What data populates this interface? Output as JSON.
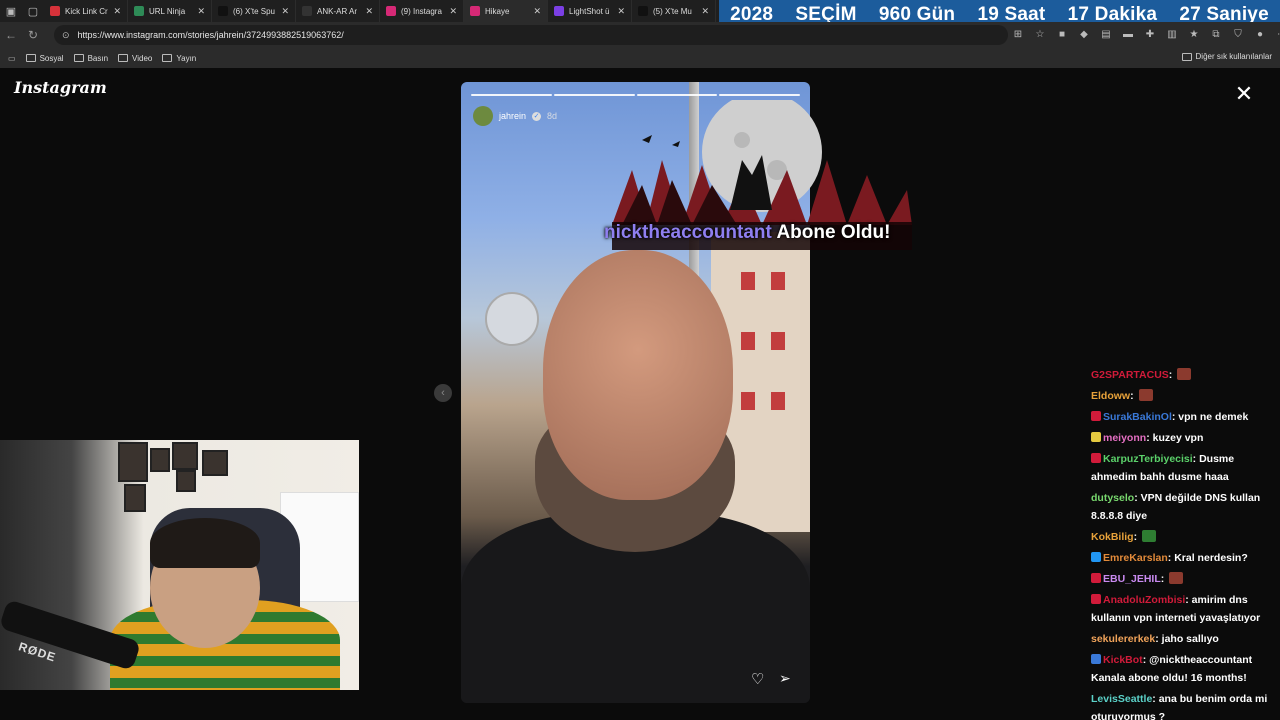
{
  "browser": {
    "tabs": [
      {
        "title": "Kick Link Cr",
        "color": "#d6323a",
        "active": false
      },
      {
        "title": "URL Ninja",
        "color": "#2e8b57",
        "active": false
      },
      {
        "title": "(6) X'te Spu",
        "color": "#111111",
        "active": false
      },
      {
        "title": "ANK-AR Ar",
        "color": "#333333",
        "active": false
      },
      {
        "title": "(9) Instagra",
        "color": "#d62976",
        "active": false
      },
      {
        "title": "Hikaye",
        "color": "#d62976",
        "active": true
      },
      {
        "title": "LightShot ü",
        "color": "#7b3fe4",
        "active": false
      },
      {
        "title": "(5) X'te Mu",
        "color": "#111111",
        "active": false
      }
    ],
    "url": "https://www.instagram.com/stories/jahrein/3724993882519063762/",
    "bookmarks": [
      "Sosyal",
      "Basın",
      "Video",
      "Yayın"
    ],
    "other_bookmarks": "Diğer sık kullanılanlar"
  },
  "countdown": {
    "year": "2028",
    "label": "SEÇİM",
    "days": "960 Gün",
    "hours": "19 Saat",
    "minutes": "17 Dakika",
    "seconds": "27 Saniye"
  },
  "instagram": {
    "logo": "Instagram",
    "story": {
      "username": "jahrein",
      "age": "8d",
      "progress_segments": 4
    }
  },
  "alert": {
    "name": "nicktheaccountant",
    "message": "Abone Oldu!"
  },
  "webcam": {
    "mic_brand": "RØDE"
  },
  "chat": [
    {
      "user": "G2SPARTACUS",
      "color": "#d11b3a",
      "text": "",
      "badge": "",
      "emote": "#8b3a2e"
    },
    {
      "user": "Eldoww",
      "color": "#e8a23a",
      "text": "",
      "badge": "",
      "emote": "#8b3a2e"
    },
    {
      "user": "SurakBakinOl",
      "color": "#3a79d8",
      "text": "vpn ne demek",
      "badge": "#d11b3a",
      "emote": ""
    },
    {
      "user": "meiyonn",
      "color": "#e56fc3",
      "text": "kuzey vpn",
      "badge": "#e4c940",
      "emote": ""
    },
    {
      "user": "KarpuzTerbiyecisi",
      "color": "#5bd16a",
      "text": "Dusme ahmedim bahh dusme haaa",
      "badge": "#d11b3a",
      "emote": ""
    },
    {
      "user": "dutyselo",
      "color": "#78d86e",
      "text": "VPN değilde DNS kullan 8.8.8.8 diye",
      "badge": "",
      "emote": ""
    },
    {
      "user": "KokBilig",
      "color": "#e8a23a",
      "text": "",
      "badge": "",
      "emote": "#2e7d32"
    },
    {
      "user": "EmreKarslan",
      "color": "#e28a3a",
      "text": "Kral nerdesin?",
      "badge": "#2196f3",
      "emote": ""
    },
    {
      "user": "EBU_JEHIL",
      "color": "#c98af0",
      "text": "",
      "badge": "#d11b3a",
      "emote": "#8b3a2e"
    },
    {
      "user": "AnadoluZombisi",
      "color": "#d11b3a",
      "text": "amirim dns kullanın vpn interneti yavaşlatıyor",
      "badge": "#d11b3a",
      "emote": ""
    },
    {
      "user": "sekulererkek",
      "color": "#f0a35a",
      "text": "jaho sallıyo",
      "badge": "",
      "emote": ""
    },
    {
      "user": "KickBot",
      "color": "#d11b3a",
      "text": "@nicktheaccountant Kanala abone oldu! 16 months!",
      "badge": "#3a79d8",
      "emote": ""
    },
    {
      "user": "LevisSeattle",
      "color": "#5bd1c8",
      "text": "ana bu benim orda mi oturuyormus ?",
      "badge": "",
      "emote": ""
    }
  ]
}
